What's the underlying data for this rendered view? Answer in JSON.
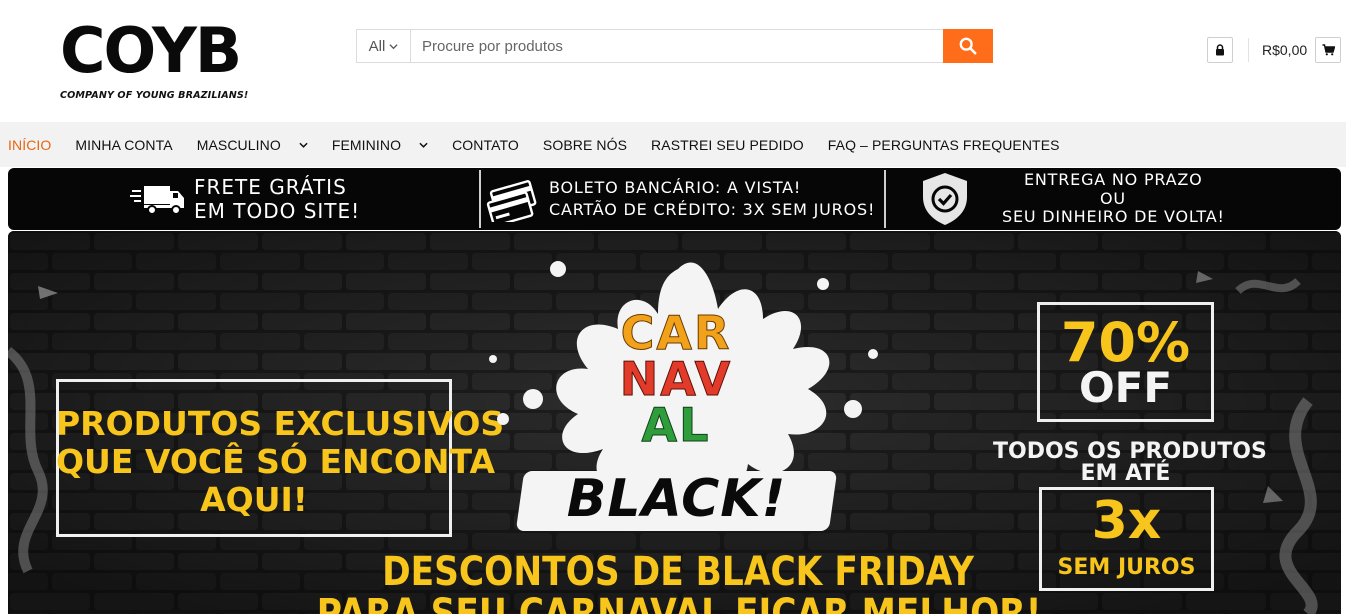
{
  "header": {
    "logo_text": "COYB",
    "logo_tagline": "COMPANY OF YOUNG BRAZILIANS!",
    "search": {
      "category": "All",
      "placeholder": "Procure por produtos"
    },
    "cart_total": "R$0,00",
    "icons": {
      "search": "search-icon",
      "lock": "lock-icon",
      "cart": "cart-icon"
    }
  },
  "nav": {
    "items": [
      {
        "label": "INÍCIO",
        "active": true,
        "dropdown": false
      },
      {
        "label": "MINHA CONTA",
        "active": false,
        "dropdown": false
      },
      {
        "label": "MASCULINO",
        "active": false,
        "dropdown": true
      },
      {
        "label": "FEMININO",
        "active": false,
        "dropdown": true
      },
      {
        "label": "CONTATO",
        "active": false,
        "dropdown": false
      },
      {
        "label": "SOBRE NÓS",
        "active": false,
        "dropdown": false
      },
      {
        "label": "RASTREI SEU PEDIDO",
        "active": false,
        "dropdown": false
      },
      {
        "label": "FAQ – PERGUNTAS FREQUENTES",
        "active": false,
        "dropdown": false
      }
    ],
    "active_color": "#e8650f"
  },
  "infobar": {
    "shipping": {
      "line1": "FRETE GRÁTIS",
      "line2": "EM TODO SITE!",
      "icon": "truck-icon"
    },
    "payment": {
      "line1": "BOLETO BANCÁRIO: A VISTA!",
      "line2": "CARTÃO DE CRÉDITO: 3X SEM JUROS!",
      "icon": "credit-card-icon"
    },
    "guarantee": {
      "line1": "ENTREGA NO PRAZO",
      "line2": "OU",
      "line3": "SEU DINHEIRO DE VOLTA!",
      "icon": "shield-check-icon"
    }
  },
  "banner": {
    "left_box": {
      "line1": "PRODUTOS EXCLUSIVOS",
      "line2": "QUE VOCÊ SÓ ENCONTA",
      "line3": "AQUI!"
    },
    "center_logo": {
      "word1": "CAR",
      "word2": "NAV",
      "word3": "AL",
      "word4": "BLACK!"
    },
    "discount": {
      "value": "70%",
      "label": "OFF"
    },
    "all_products": {
      "line1": "TODOS OS PRODUTOS",
      "line2": "EM ATÉ"
    },
    "installments": {
      "value": "3x",
      "label": "SEM JUROS"
    },
    "bottom": {
      "line1": "DESCONTOS DE BLACK FRIDAY",
      "line2": "PARA SEU CARNAVAL FICAR MELHOR!"
    },
    "accent_color": "#f7c51b"
  },
  "colors": {
    "brand_orange": "#ff6d1a"
  }
}
